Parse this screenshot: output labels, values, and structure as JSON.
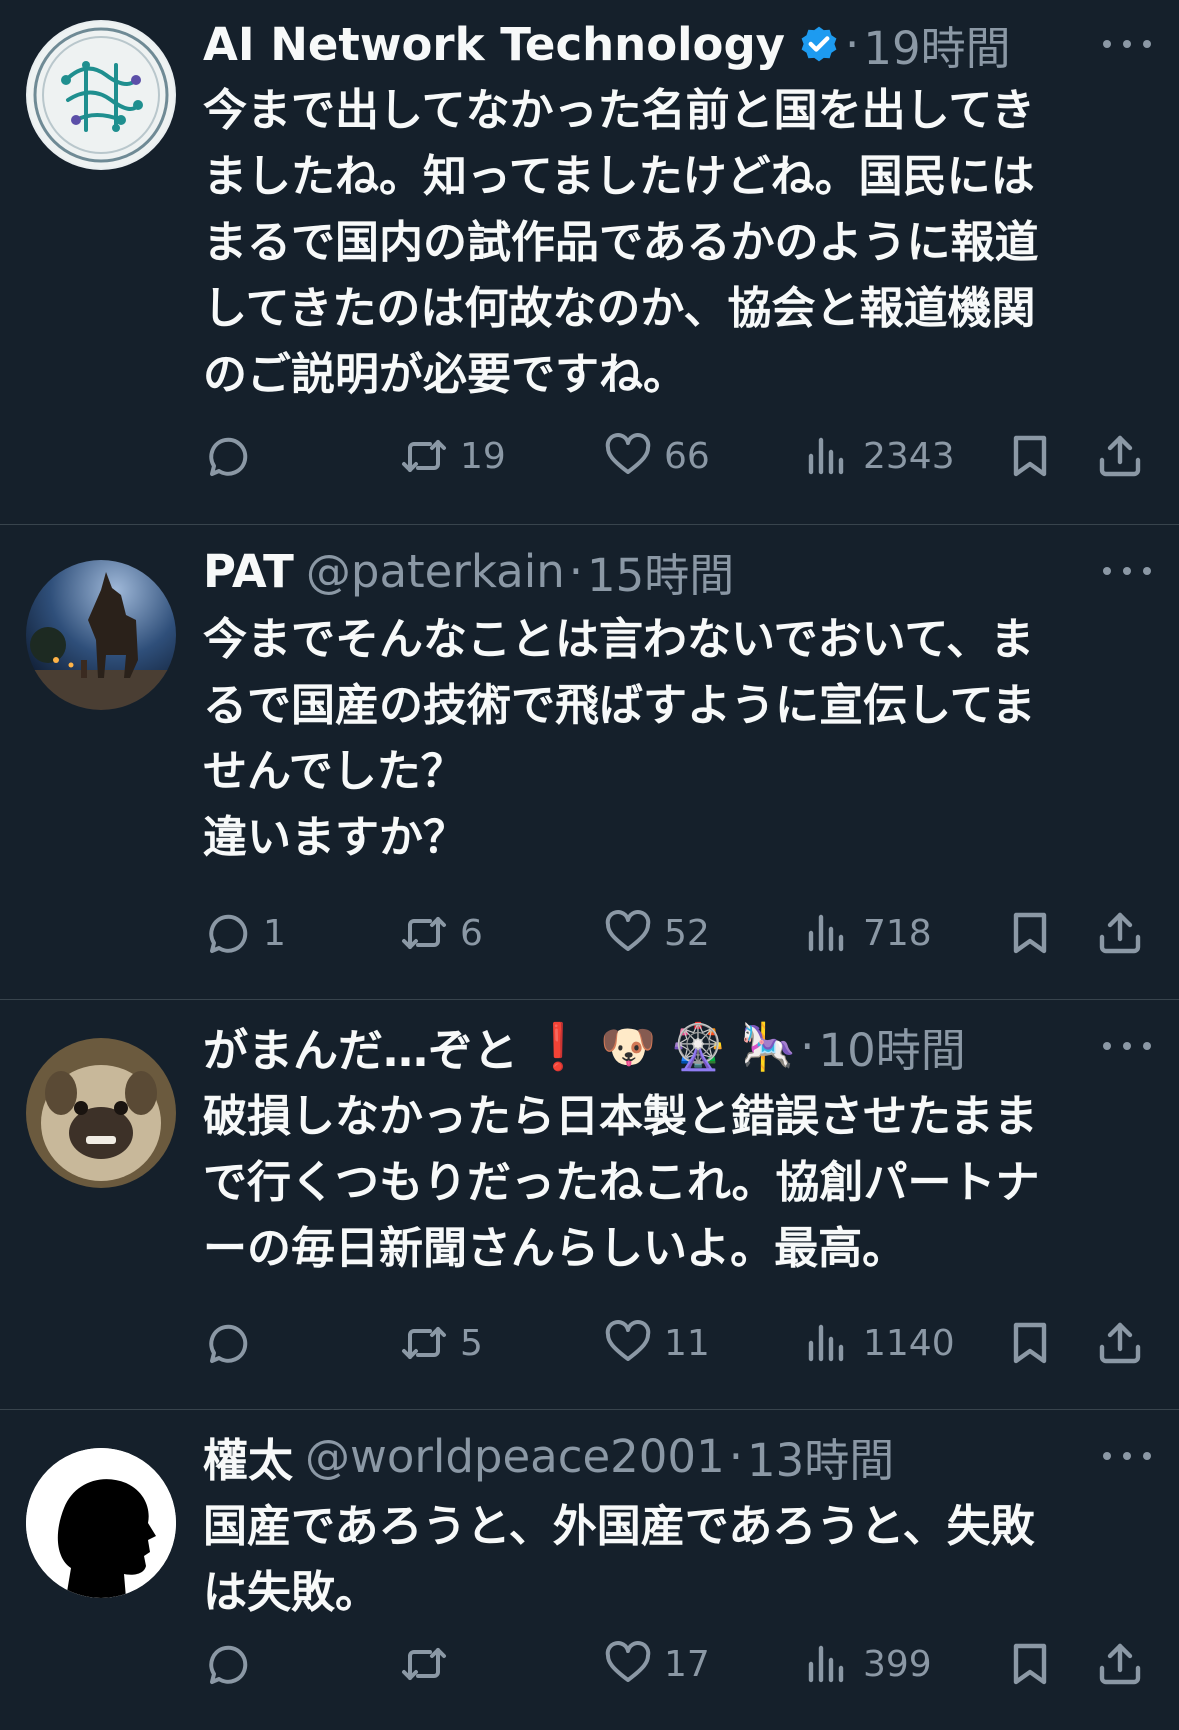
{
  "tweets": [
    {
      "name": "AI Network Technology",
      "handle": "",
      "verified": true,
      "time": "19時間",
      "text": "今まで出してなかった名前と国を出してき\nましたね。知ってましたけどね。国民には\nまるで国内の試作品であるかのように報道\nしてきたのは何故なのか、協会と報道機関\nのご説明が必要ですね。",
      "avatar": "circuit-logo",
      "replies": "",
      "retweets": "19",
      "likes": "66",
      "views": "2343"
    },
    {
      "name": "PAT",
      "handle": "@paterkain",
      "verified": false,
      "time": "15時間",
      "text": "今までそんなことは言わないでおいて、ま\nるで国産の技術で飛ばすように宣伝してま\nせんでした？\n違いますか？",
      "avatar": "trojan-horse-photo",
      "replies": "1",
      "retweets": "6",
      "likes": "52",
      "views": "718"
    },
    {
      "name": "がまんだ…ぞと",
      "handle": "",
      "verified": false,
      "time": "10時間",
      "emojis": [
        "❗",
        "🐶",
        "🎡",
        "🎠"
      ],
      "text": "破損しなかったら日本製と錯誤させたまま\nで行くつもりだったねこれ。協創パートナ\nーの毎日新聞さんらしいよ。最高。",
      "avatar": "pug-photo",
      "replies": "",
      "retweets": "5",
      "likes": "11",
      "views": "1140"
    },
    {
      "name": "權太",
      "handle": "@worldpeace2001",
      "verified": false,
      "time": "13時間",
      "text": "国産であろうと、外国産であろうと、失敗\nは失敗。",
      "avatar": "silhouette-profile",
      "replies": "",
      "retweets": "",
      "likes": "17",
      "views": "399"
    }
  ],
  "colors": {
    "background": "#15202b",
    "text": "#f7f9f9",
    "secondary": "#8b98a5",
    "divider": "#38444d",
    "verified": "#1d9bf0"
  },
  "icons": [
    "reply-icon",
    "retweet-icon",
    "like-icon",
    "views-icon",
    "bookmark-icon",
    "share-icon",
    "more-icon",
    "verified-badge-icon"
  ]
}
